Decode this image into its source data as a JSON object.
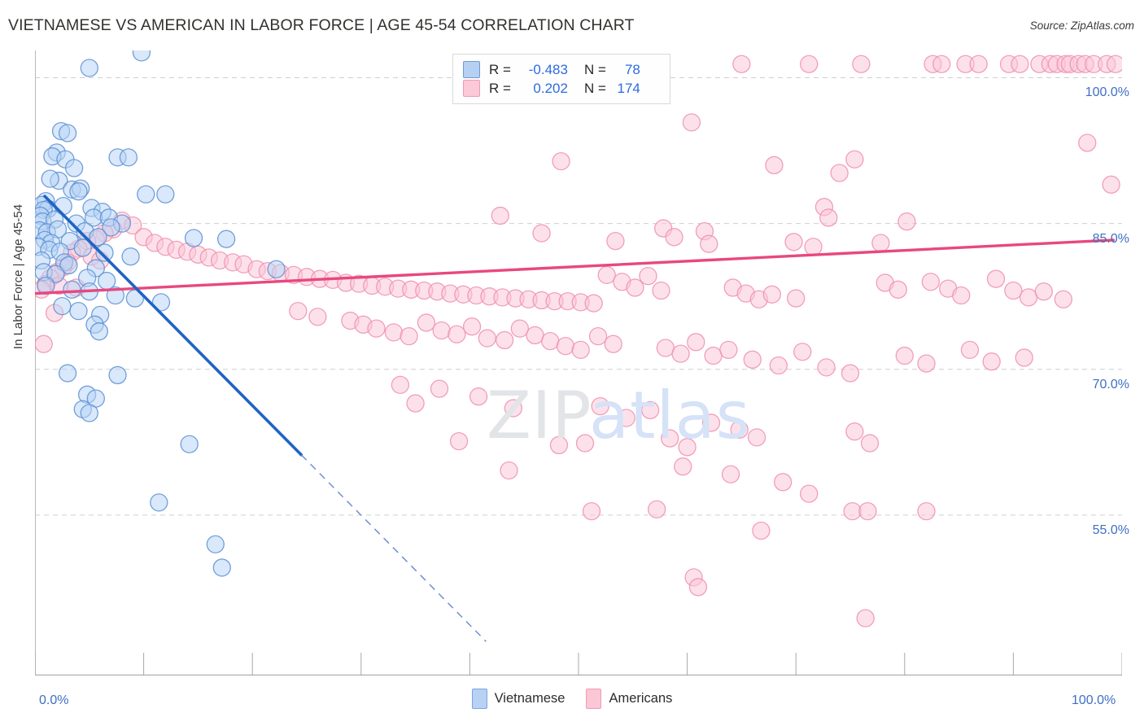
{
  "header": {
    "title": "VIETNAMESE VS AMERICAN IN LABOR FORCE | AGE 45-54 CORRELATION CHART",
    "source": "Source: ZipAtlas.com"
  },
  "watermark": {
    "part1": "ZIP",
    "part2": "atlas"
  },
  "stat_legend": {
    "rows": [
      {
        "series": "Vietnamese",
        "r_label": "R =",
        "r_value": "-0.483",
        "n_label": "N =",
        "n_value": "78",
        "color": "#b6d0f2"
      },
      {
        "series": "Americans",
        "r_label": "R =",
        "r_value": "0.202",
        "n_label": "N =",
        "n_value": "174",
        "color": "#fbc9d8"
      }
    ]
  },
  "bottom_legend": {
    "items": [
      {
        "label": "Vietnamese",
        "color": "#b7d2f5"
      },
      {
        "label": "Americans",
        "color": "#fbc6d6"
      }
    ]
  },
  "axes": {
    "y_title": "In Labor Force | Age 45-54",
    "y_ticks": [
      "100.0%",
      "85.0%",
      "70.0%",
      "55.0%"
    ],
    "x_min_label": "0.0%",
    "x_max_label": "100.0%"
  },
  "chart_data": {
    "type": "scatter",
    "title": "VIETNAMESE VS AMERICAN IN LABOR FORCE | AGE 45-54 CORRELATION CHART",
    "xlabel": "",
    "ylabel": "In Labor Force | Age 45-54",
    "xlim": [
      0,
      100
    ],
    "ylim": [
      38.5,
      102.8
    ],
    "x_ticks": [
      0,
      10,
      20,
      30,
      40,
      50,
      60,
      70,
      80,
      90,
      100
    ],
    "y_ticks": [
      55,
      70,
      85,
      100
    ],
    "grid": "horizontal-dashed",
    "legend_position": "bottom-center",
    "series": [
      {
        "name": "Vietnamese",
        "color": "#b7d2f5",
        "edge_color": "#5b8fd4",
        "r": -0.483,
        "n": 78,
        "trendline": {
          "x0": 0.9,
          "y0": 87.8,
          "x1": 24.5,
          "y1": 61.2,
          "style": "solid",
          "extension": {
            "x1": 41.5,
            "y1": 42.0,
            "style": "dashed"
          }
        },
        "points": [
          [
            5.0,
            101.0
          ],
          [
            9.8,
            102.6
          ],
          [
            2.4,
            94.5
          ],
          [
            3.0,
            94.3
          ],
          [
            2.0,
            92.3
          ],
          [
            1.6,
            91.9
          ],
          [
            2.8,
            91.6
          ],
          [
            7.6,
            91.8
          ],
          [
            8.6,
            91.8
          ],
          [
            3.6,
            90.7
          ],
          [
            2.2,
            89.4
          ],
          [
            1.4,
            89.6
          ],
          [
            3.4,
            88.5
          ],
          [
            4.2,
            88.6
          ],
          [
            4.0,
            88.3
          ],
          [
            10.2,
            88.0
          ],
          [
            12.0,
            88.0
          ],
          [
            1.0,
            87.3
          ],
          [
            0.6,
            86.9
          ],
          [
            1.2,
            86.5
          ],
          [
            0.8,
            86.4
          ],
          [
            2.6,
            86.8
          ],
          [
            5.2,
            86.6
          ],
          [
            6.2,
            86.2
          ],
          [
            5.4,
            85.6
          ],
          [
            0.5,
            85.8
          ],
          [
            0.7,
            85.2
          ],
          [
            1.8,
            85.4
          ],
          [
            3.8,
            85.0
          ],
          [
            6.8,
            85.6
          ],
          [
            8.0,
            85.0
          ],
          [
            7.0,
            84.6
          ],
          [
            0.4,
            84.3
          ],
          [
            1.1,
            84.1
          ],
          [
            2.1,
            84.4
          ],
          [
            4.6,
            84.2
          ],
          [
            5.8,
            83.6
          ],
          [
            0.9,
            83.3
          ],
          [
            1.5,
            83.0
          ],
          [
            3.2,
            83.2
          ],
          [
            14.6,
            83.5
          ],
          [
            17.6,
            83.4
          ],
          [
            0.3,
            82.6
          ],
          [
            1.3,
            82.3
          ],
          [
            2.3,
            82.1
          ],
          [
            4.4,
            82.5
          ],
          [
            6.4,
            82.0
          ],
          [
            8.8,
            81.6
          ],
          [
            0.6,
            81.2
          ],
          [
            2.7,
            81.0
          ],
          [
            3.1,
            80.7
          ],
          [
            5.6,
            80.4
          ],
          [
            22.2,
            80.3
          ],
          [
            0.8,
            80.0
          ],
          [
            1.9,
            79.8
          ],
          [
            4.8,
            79.4
          ],
          [
            6.6,
            79.1
          ],
          [
            1.0,
            78.6
          ],
          [
            3.4,
            78.2
          ],
          [
            5.0,
            78.0
          ],
          [
            7.4,
            77.6
          ],
          [
            9.2,
            77.3
          ],
          [
            11.6,
            76.9
          ],
          [
            2.5,
            76.5
          ],
          [
            4.0,
            76.0
          ],
          [
            6.0,
            75.6
          ],
          [
            5.5,
            74.6
          ],
          [
            5.9,
            73.9
          ],
          [
            3.0,
            69.6
          ],
          [
            7.6,
            69.4
          ],
          [
            4.8,
            67.4
          ],
          [
            5.6,
            67.0
          ],
          [
            4.4,
            65.9
          ],
          [
            5.0,
            65.5
          ],
          [
            14.2,
            62.3
          ],
          [
            11.4,
            56.3
          ],
          [
            16.6,
            52.0
          ],
          [
            17.2,
            49.6
          ]
        ]
      },
      {
        "name": "Americans",
        "color": "#fbc6d6",
        "edge_color": "#ee8fae",
        "r": 0.202,
        "n": 174,
        "trendline": {
          "x0": 0.0,
          "y0": 77.8,
          "x1": 99.2,
          "y1": 83.3,
          "style": "solid"
        },
        "points": [
          [
            65.0,
            101.4
          ],
          [
            71.2,
            101.4
          ],
          [
            76.0,
            101.4
          ],
          [
            82.6,
            101.4
          ],
          [
            83.4,
            101.4
          ],
          [
            85.6,
            101.4
          ],
          [
            86.8,
            101.4
          ],
          [
            89.6,
            101.4
          ],
          [
            90.6,
            101.4
          ],
          [
            92.4,
            101.4
          ],
          [
            93.4,
            101.4
          ],
          [
            94.0,
            101.4
          ],
          [
            94.8,
            101.4
          ],
          [
            95.2,
            101.4
          ],
          [
            96.0,
            101.4
          ],
          [
            96.6,
            101.4
          ],
          [
            97.4,
            101.4
          ],
          [
            98.6,
            101.4
          ],
          [
            99.4,
            101.4
          ],
          [
            104.0,
            101.4
          ],
          [
            60.4,
            95.4
          ],
          [
            96.8,
            93.3
          ],
          [
            48.4,
            91.4
          ],
          [
            68.0,
            91.0
          ],
          [
            75.4,
            91.6
          ],
          [
            74.0,
            90.2
          ],
          [
            99.0,
            89.0
          ],
          [
            72.6,
            86.7
          ],
          [
            42.8,
            85.8
          ],
          [
            73.0,
            85.6
          ],
          [
            80.2,
            85.2
          ],
          [
            46.6,
            84.0
          ],
          [
            57.8,
            84.5
          ],
          [
            58.8,
            83.6
          ],
          [
            61.6,
            84.2
          ],
          [
            53.4,
            83.2
          ],
          [
            62.0,
            82.9
          ],
          [
            69.8,
            83.1
          ],
          [
            71.6,
            82.6
          ],
          [
            77.8,
            83.0
          ],
          [
            8.0,
            85.3
          ],
          [
            9.0,
            84.8
          ],
          [
            7.2,
            84.4
          ],
          [
            6.4,
            84.0
          ],
          [
            10.0,
            83.6
          ],
          [
            5.6,
            83.4
          ],
          [
            4.8,
            83.2
          ],
          [
            11.0,
            83.0
          ],
          [
            12.0,
            82.6
          ],
          [
            13.0,
            82.3
          ],
          [
            14.0,
            82.1
          ],
          [
            4.0,
            82.4
          ],
          [
            3.4,
            82.0
          ],
          [
            15.0,
            81.8
          ],
          [
            16.0,
            81.5
          ],
          [
            17.0,
            81.2
          ],
          [
            18.2,
            81.0
          ],
          [
            19.2,
            80.8
          ],
          [
            5.2,
            81.6
          ],
          [
            6.0,
            81.2
          ],
          [
            20.4,
            80.3
          ],
          [
            21.4,
            80.1
          ],
          [
            22.6,
            79.9
          ],
          [
            23.8,
            79.7
          ],
          [
            25.0,
            79.5
          ],
          [
            26.2,
            79.3
          ],
          [
            27.4,
            79.2
          ],
          [
            3.0,
            81.0
          ],
          [
            2.6,
            80.5
          ],
          [
            2.0,
            80.0
          ],
          [
            28.6,
            78.9
          ],
          [
            29.8,
            78.8
          ],
          [
            31.0,
            78.6
          ],
          [
            32.2,
            78.5
          ],
          [
            33.4,
            78.3
          ],
          [
            34.6,
            78.2
          ],
          [
            35.8,
            78.1
          ],
          [
            37.0,
            78.0
          ],
          [
            38.2,
            77.8
          ],
          [
            39.4,
            77.7
          ],
          [
            40.6,
            77.6
          ],
          [
            41.8,
            77.5
          ],
          [
            43.0,
            77.4
          ],
          [
            44.2,
            77.3
          ],
          [
            45.4,
            77.2
          ],
          [
            46.6,
            77.1
          ],
          [
            47.8,
            77.0
          ],
          [
            49.0,
            77.0
          ],
          [
            50.2,
            76.9
          ],
          [
            51.4,
            76.8
          ],
          [
            1.4,
            79.4
          ],
          [
            1.0,
            78.8
          ],
          [
            0.6,
            78.2
          ],
          [
            2.2,
            78.6
          ],
          [
            3.8,
            78.4
          ],
          [
            52.6,
            79.7
          ],
          [
            54.0,
            79.0
          ],
          [
            55.2,
            78.4
          ],
          [
            56.4,
            79.6
          ],
          [
            57.6,
            78.1
          ],
          [
            64.2,
            78.4
          ],
          [
            65.4,
            77.8
          ],
          [
            66.6,
            77.2
          ],
          [
            67.8,
            77.7
          ],
          [
            70.0,
            77.3
          ],
          [
            78.2,
            78.9
          ],
          [
            79.4,
            78.2
          ],
          [
            82.4,
            79.0
          ],
          [
            84.0,
            78.3
          ],
          [
            85.2,
            77.6
          ],
          [
            88.4,
            79.3
          ],
          [
            90.0,
            78.1
          ],
          [
            91.4,
            77.4
          ],
          [
            92.8,
            78.0
          ],
          [
            94.6,
            77.2
          ],
          [
            24.2,
            76.0
          ],
          [
            26.0,
            75.4
          ],
          [
            29.0,
            75.0
          ],
          [
            30.2,
            74.6
          ],
          [
            31.4,
            74.2
          ],
          [
            33.0,
            73.8
          ],
          [
            34.4,
            73.4
          ],
          [
            36.0,
            74.8
          ],
          [
            37.4,
            74.0
          ],
          [
            38.8,
            73.6
          ],
          [
            40.2,
            74.4
          ],
          [
            41.6,
            73.2
          ],
          [
            43.2,
            73.0
          ],
          [
            44.6,
            74.2
          ],
          [
            46.0,
            73.5
          ],
          [
            47.4,
            72.9
          ],
          [
            48.8,
            72.4
          ],
          [
            50.2,
            72.0
          ],
          [
            51.8,
            73.4
          ],
          [
            53.2,
            72.6
          ],
          [
            58.0,
            72.2
          ],
          [
            59.4,
            71.6
          ],
          [
            60.8,
            72.8
          ],
          [
            62.4,
            71.4
          ],
          [
            63.8,
            72.0
          ],
          [
            66.0,
            71.0
          ],
          [
            68.4,
            70.4
          ],
          [
            70.6,
            71.8
          ],
          [
            72.8,
            70.2
          ],
          [
            75.0,
            69.6
          ],
          [
            80.0,
            71.4
          ],
          [
            82.0,
            70.6
          ],
          [
            86.0,
            72.0
          ],
          [
            88.0,
            70.8
          ],
          [
            91.0,
            71.2
          ],
          [
            1.8,
            75.8
          ],
          [
            0.8,
            72.6
          ],
          [
            33.6,
            68.4
          ],
          [
            37.2,
            68.0
          ],
          [
            35.0,
            66.5
          ],
          [
            40.8,
            67.2
          ],
          [
            44.0,
            66.0
          ],
          [
            52.0,
            66.2
          ],
          [
            54.4,
            65.0
          ],
          [
            56.6,
            65.8
          ],
          [
            39.0,
            62.6
          ],
          [
            48.2,
            62.2
          ],
          [
            50.6,
            62.4
          ],
          [
            58.4,
            62.9
          ],
          [
            60.0,
            62.0
          ],
          [
            62.2,
            64.5
          ],
          [
            64.8,
            63.8
          ],
          [
            66.4,
            63.0
          ],
          [
            75.4,
            63.6
          ],
          [
            76.8,
            62.4
          ],
          [
            43.6,
            59.6
          ],
          [
            59.6,
            60.0
          ],
          [
            64.0,
            59.2
          ],
          [
            68.8,
            58.4
          ],
          [
            71.2,
            57.2
          ],
          [
            51.2,
            55.4
          ],
          [
            57.2,
            55.6
          ],
          [
            66.8,
            53.4
          ],
          [
            75.2,
            55.4
          ],
          [
            76.6,
            55.4
          ],
          [
            82.0,
            55.4
          ],
          [
            60.6,
            48.6
          ],
          [
            61.0,
            47.6
          ],
          [
            76.4,
            44.4
          ]
        ]
      }
    ]
  }
}
